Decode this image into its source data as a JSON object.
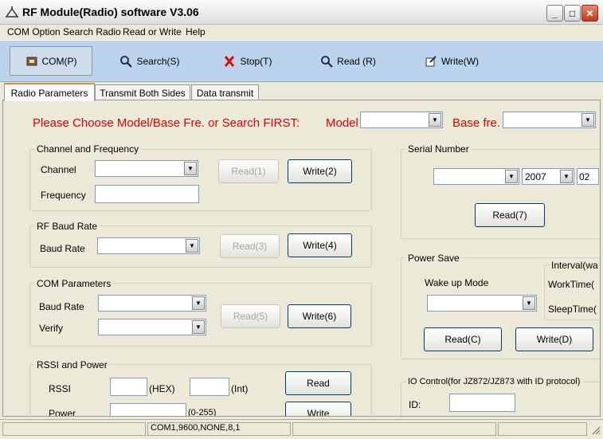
{
  "window": {
    "title": "RF Module(Radio) software  V3.06",
    "min": "_",
    "max": "□",
    "close": "✕"
  },
  "menu": [
    "COM Option",
    "Search Radio",
    "Read or Write",
    "Help"
  ],
  "toolbar": [
    {
      "label": "COM(P)",
      "icon": "com-port-icon"
    },
    {
      "label": "Search(S)",
      "icon": "magnifier-icon"
    },
    {
      "label": "Stop(T)",
      "icon": "stop-x-icon"
    },
    {
      "label": "Read (R)",
      "icon": "magnifier-icon"
    },
    {
      "label": "Write(W)",
      "icon": "write-icon"
    }
  ],
  "tabs": [
    "Radio Parameters",
    "Transmit Both Sides",
    "Data transmit"
  ],
  "hint": {
    "text": "Please Choose Model/Base Fre. or Search FIRST:",
    "model_label": "Model",
    "base_label": "Base fre."
  },
  "channel_group": {
    "title": "Channel and Frequency",
    "channel_label": "Channel",
    "frequency_label": "Frequency",
    "read": "Read(1)",
    "write": "Write(2)"
  },
  "baud_group": {
    "title": "RF Baud Rate",
    "baud_label": "Baud Rate",
    "read": "Read(3)",
    "write": "Write(4)"
  },
  "com_group": {
    "title": "COM Parameters",
    "baud_label": "Baud Rate",
    "verify_label": "Verify",
    "read": "Read(5)",
    "write": "Write(6)"
  },
  "rssi_group": {
    "title": "RSSI and Power",
    "rssi_label": "RSSI",
    "hex": "(HEX)",
    "int": "(Int)",
    "power_label": "Power",
    "range": "(0-255)",
    "read": "Read",
    "write": "Write"
  },
  "serial_group": {
    "title": "Serial Number",
    "year": "2007",
    "month": "02",
    "read": "Read(7)"
  },
  "power_group": {
    "title": "Power Save",
    "wakeup_label": "Wake up Mode",
    "interval_title": "Interval(wa",
    "worktime": "WorkTime(",
    "sleeptime": "SleepTime(",
    "read": "Read(C)",
    "write": "Write(D)"
  },
  "io_group": {
    "title": "IO Control(for JZ872/JZ873 with ID protocol)",
    "id_label": "ID:"
  },
  "status": [
    "",
    "COM1,9600,NONE,8,1",
    "",
    "",
    ""
  ]
}
